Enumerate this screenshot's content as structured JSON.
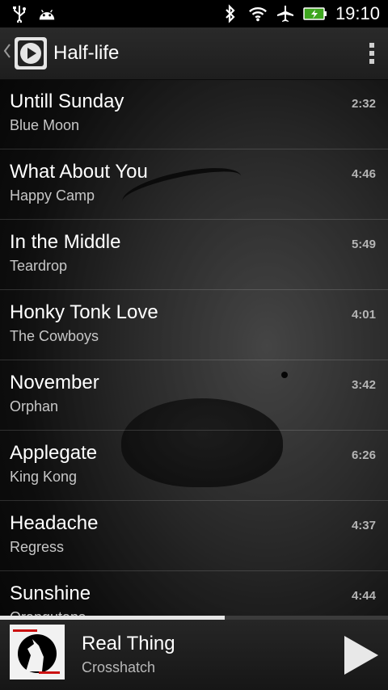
{
  "status_bar": {
    "time": "19:10",
    "left_icons": [
      "usb-icon",
      "android-icon"
    ],
    "right_icons": [
      "bluetooth-icon",
      "wifi-icon",
      "airplane-icon",
      "battery-charging-icon"
    ]
  },
  "action_bar": {
    "title": "Half-life",
    "icons": [
      "back-caret-icon",
      "play-app-icon",
      "overflow-menu-icon"
    ]
  },
  "tracks": [
    {
      "title": "Untill Sunday",
      "artist": "Blue Moon",
      "duration": "2:32"
    },
    {
      "title": "What About You",
      "artist": "Happy Camp",
      "duration": "4:46"
    },
    {
      "title": "In the Middle",
      "artist": "Teardrop",
      "duration": "5:49"
    },
    {
      "title": "Honky Tonk Love",
      "artist": "The Cowboys",
      "duration": "4:01"
    },
    {
      "title": "November",
      "artist": "Orphan",
      "duration": "3:42"
    },
    {
      "title": "Applegate",
      "artist": "King Kong",
      "duration": "6:26"
    },
    {
      "title": "Headache",
      "artist": "Regress",
      "duration": "4:37"
    },
    {
      "title": "Sunshine",
      "artist": "Orangutans",
      "duration": "4:44"
    }
  ],
  "playback_progress_fraction": 0.58,
  "now_playing": {
    "title": "Real Thing",
    "artist": "Crosshatch",
    "album_art_colors": {
      "background": "#f2f2f2",
      "figure": "#000000",
      "accent": "#cc1111"
    }
  }
}
